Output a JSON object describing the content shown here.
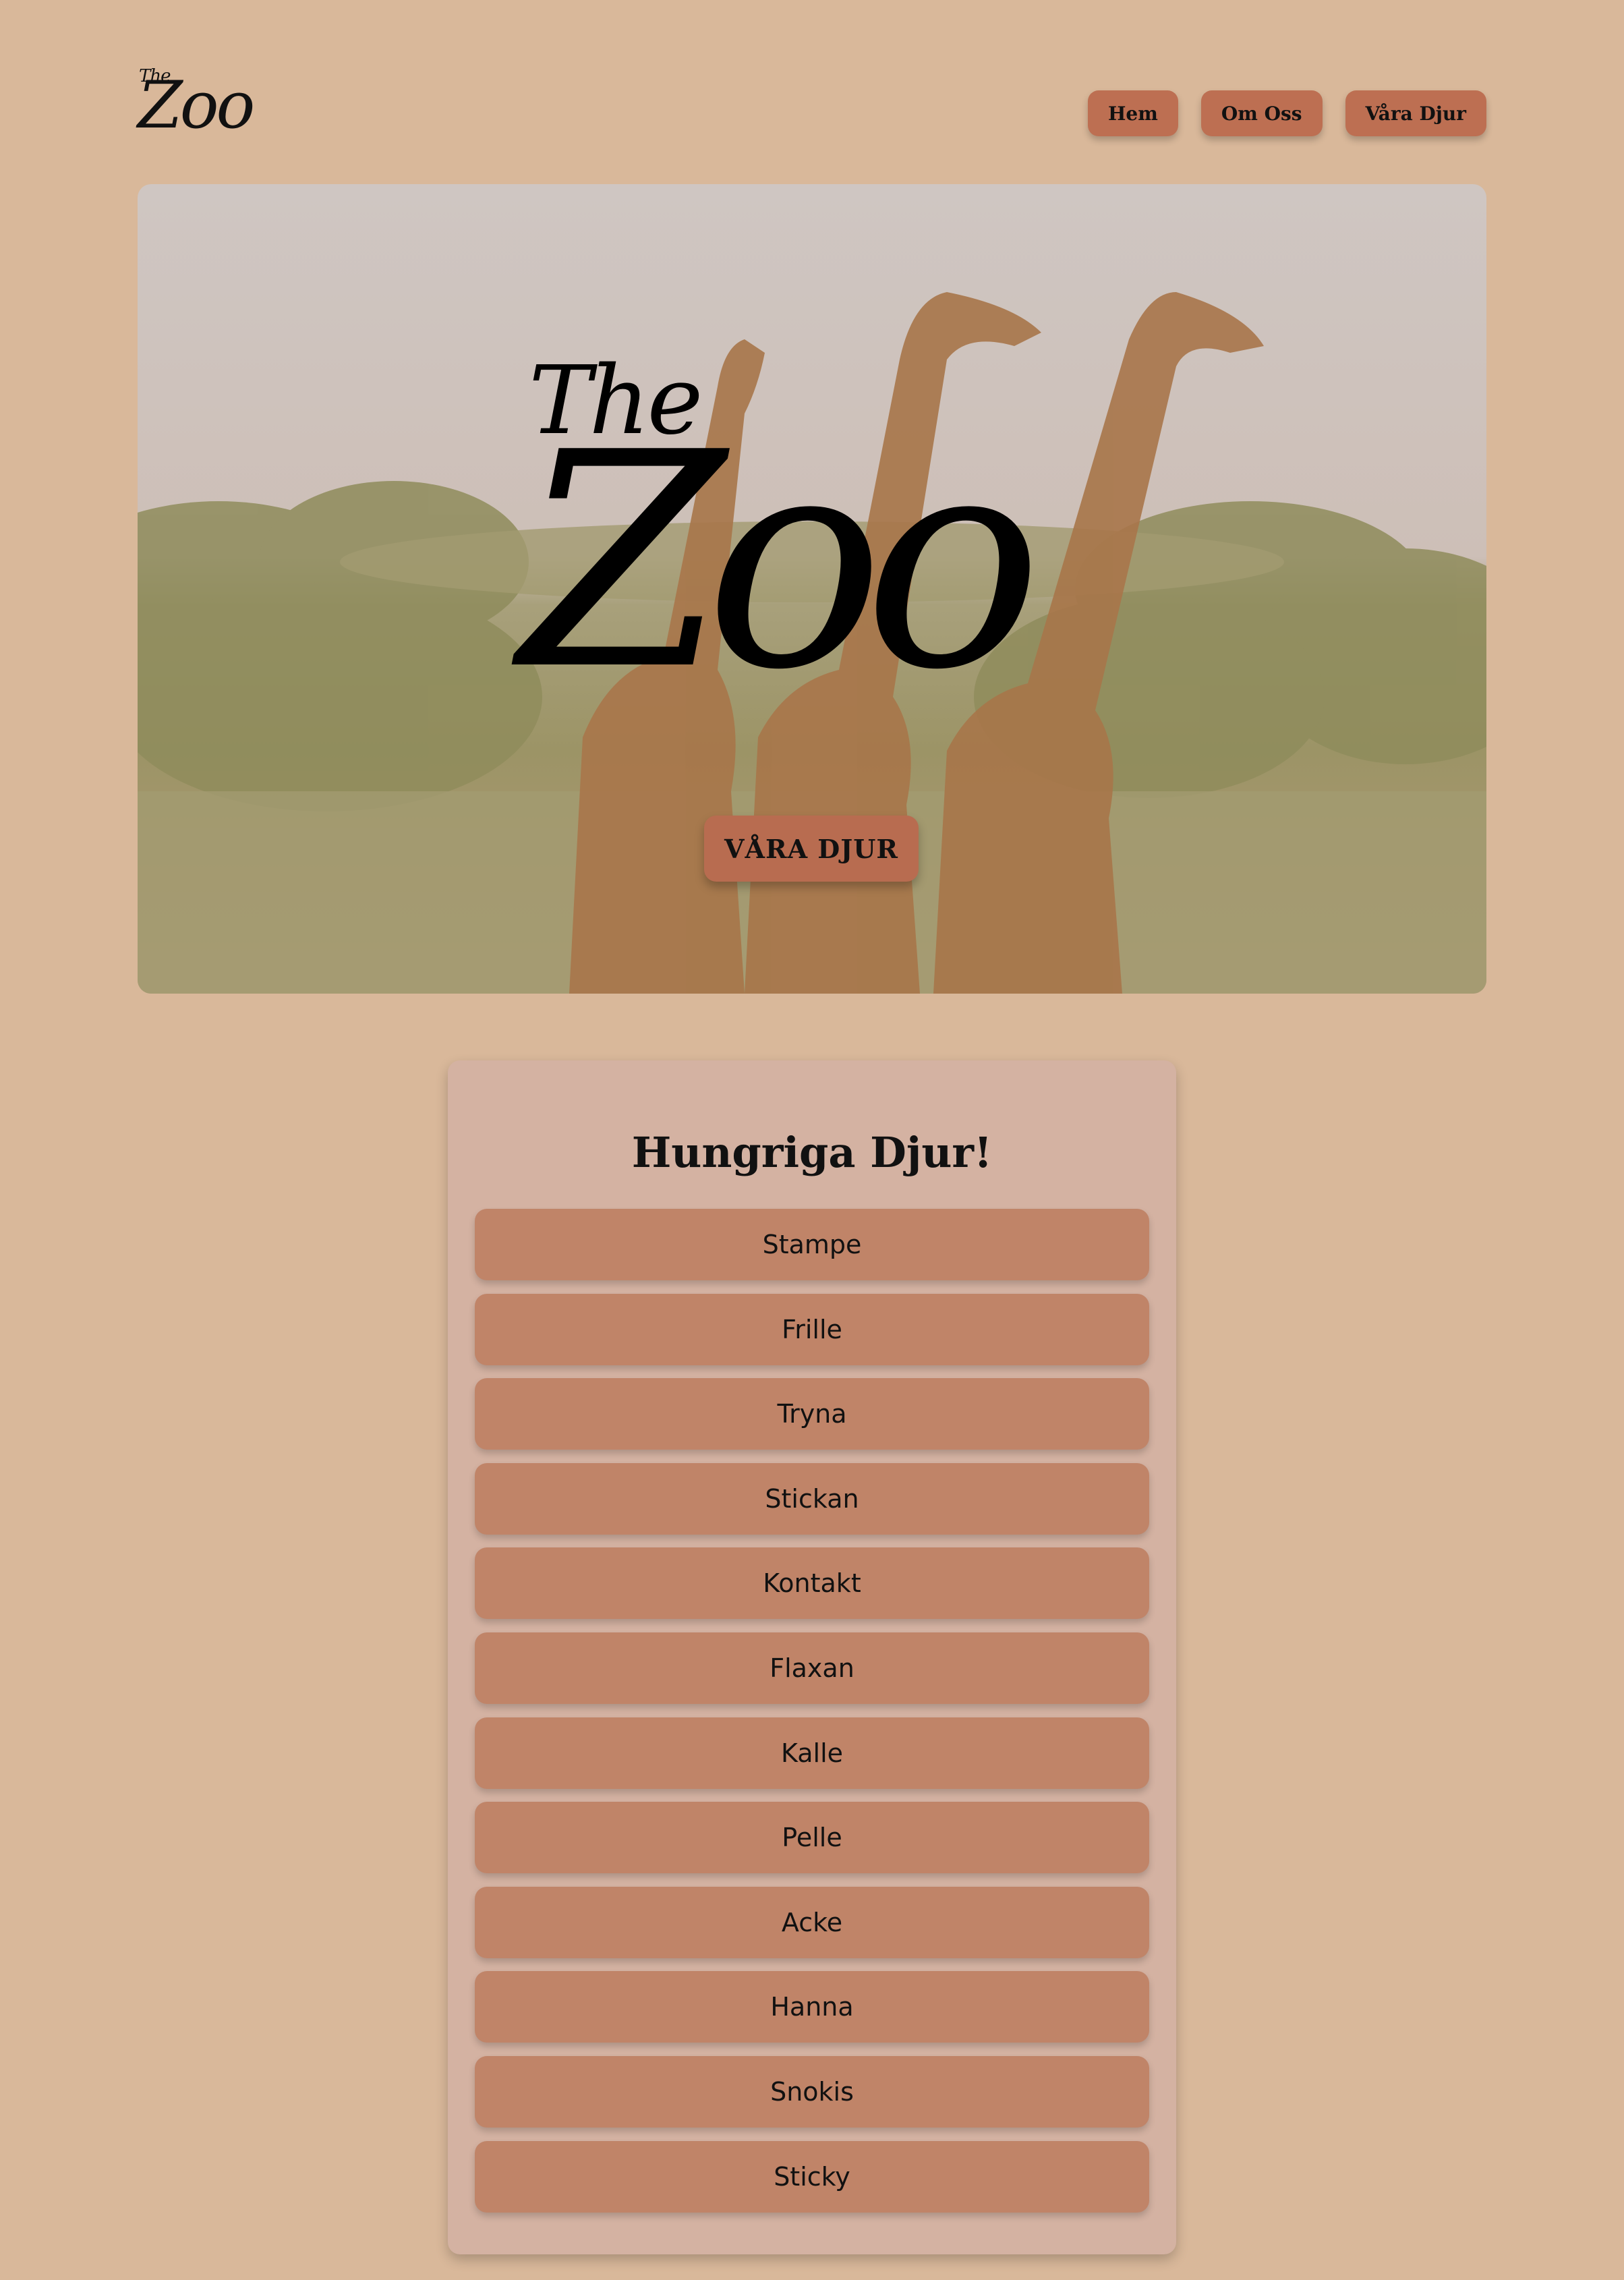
{
  "header": {
    "logo_small": "The",
    "logo_large": "Zoo",
    "nav": [
      {
        "label": "Hem"
      },
      {
        "label": "Om Oss"
      },
      {
        "label": "Våra Djur"
      }
    ]
  },
  "hero": {
    "title_small": "The",
    "title_large": "Zoo",
    "cta_label": "VÅRA DJUR"
  },
  "hungry": {
    "title": "Hungriga Djur!",
    "animals": [
      "Stampe",
      "Frille",
      "Tryna",
      "Stickan",
      "Kontakt",
      "Flaxan",
      "Kalle",
      "Pelle",
      "Acke",
      "Hanna",
      "Snokis",
      "Sticky"
    ]
  },
  "colors": {
    "background": "#d9b89a",
    "button": "#bd6f52",
    "card": "#d4b2a2",
    "list_button": "#c08468"
  }
}
